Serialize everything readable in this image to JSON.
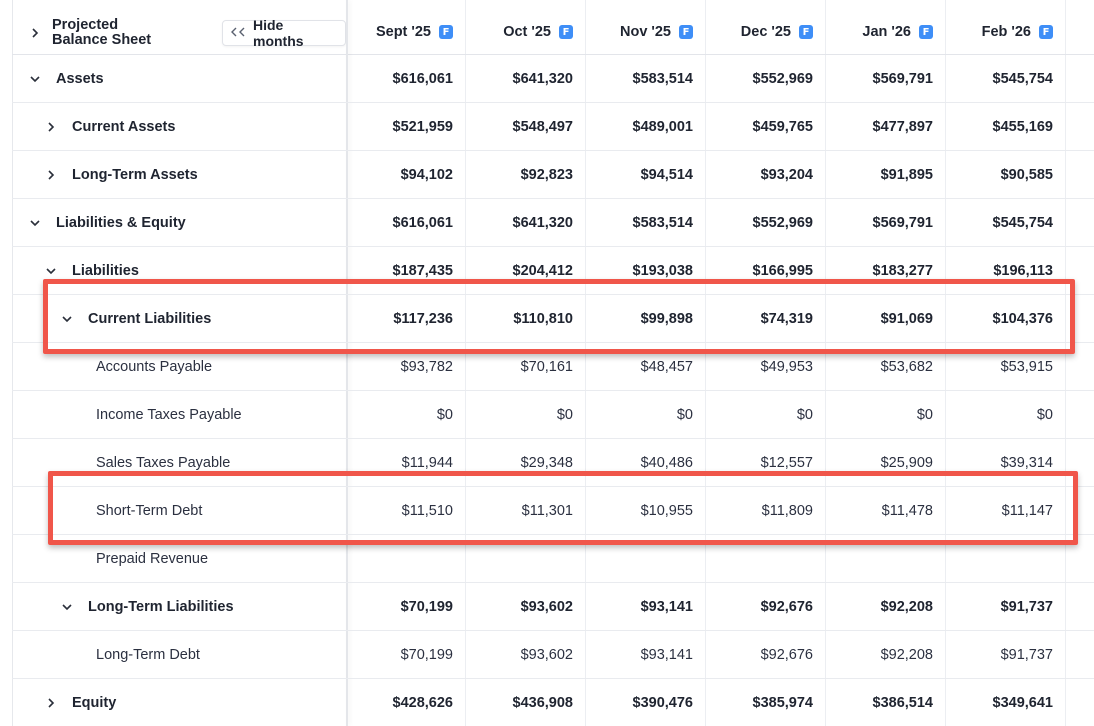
{
  "header": {
    "title_line1": "Projected",
    "title_line2": "Balance Sheet",
    "hide_months_label": "Hide months",
    "forecast_badge": "F",
    "months": [
      "Sept '25",
      "Oct '25",
      "Nov '25",
      "Dec '25",
      "Jan '26",
      "Feb '26"
    ]
  },
  "rows": [
    {
      "label": "Assets",
      "values": [
        "$616,061",
        "$641,320",
        "$583,514",
        "$552,969",
        "$569,791",
        "$545,754"
      ]
    },
    {
      "label": "Current Assets",
      "values": [
        "$521,959",
        "$548,497",
        "$489,001",
        "$459,765",
        "$477,897",
        "$455,169"
      ]
    },
    {
      "label": "Long-Term Assets",
      "values": [
        "$94,102",
        "$92,823",
        "$94,514",
        "$93,204",
        "$91,895",
        "$90,585"
      ]
    },
    {
      "label": "Liabilities & Equity",
      "values": [
        "$616,061",
        "$641,320",
        "$583,514",
        "$552,969",
        "$569,791",
        "$545,754"
      ]
    },
    {
      "label": "Liabilities",
      "values": [
        "$187,435",
        "$204,412",
        "$193,038",
        "$166,995",
        "$183,277",
        "$196,113"
      ]
    },
    {
      "label": "Current Liabilities",
      "values": [
        "$117,236",
        "$110,810",
        "$99,898",
        "$74,319",
        "$91,069",
        "$104,376"
      ]
    },
    {
      "label": "Accounts Payable",
      "values": [
        "$93,782",
        "$70,161",
        "$48,457",
        "$49,953",
        "$53,682",
        "$53,915"
      ]
    },
    {
      "label": "Income Taxes Payable",
      "values": [
        "$0",
        "$0",
        "$0",
        "$0",
        "$0",
        "$0"
      ]
    },
    {
      "label": "Sales Taxes Payable",
      "values": [
        "$11,944",
        "$29,348",
        "$40,486",
        "$12,557",
        "$25,909",
        "$39,314"
      ]
    },
    {
      "label": "Short-Term Debt",
      "values": [
        "$11,510",
        "$11,301",
        "$10,955",
        "$11,809",
        "$11,478",
        "$11,147"
      ]
    },
    {
      "label": "Prepaid Revenue",
      "values": [
        "",
        "",
        "",
        "",
        "",
        ""
      ]
    },
    {
      "label": "Long-Term Liabilities",
      "values": [
        "$70,199",
        "$93,602",
        "$93,141",
        "$92,676",
        "$92,208",
        "$91,737"
      ]
    },
    {
      "label": "Long-Term Debt",
      "values": [
        "$70,199",
        "$93,602",
        "$93,141",
        "$92,676",
        "$92,208",
        "$91,737"
      ]
    },
    {
      "label": "Equity",
      "values": [
        "$428,626",
        "$436,908",
        "$390,476",
        "$385,974",
        "$386,514",
        "$349,641"
      ]
    }
  ],
  "colors": {
    "highlight": "#f0564a",
    "badge": "#3e8ef7"
  }
}
